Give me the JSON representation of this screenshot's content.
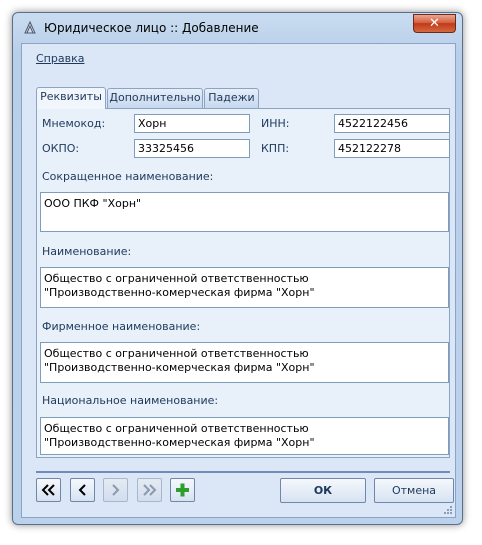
{
  "window": {
    "title": "Юридическое лицо :: Добавление",
    "close_label": "✕"
  },
  "menu": {
    "help": "Справка"
  },
  "tabs": [
    {
      "label": "Реквизиты",
      "active": true
    },
    {
      "label": "Дополнительно",
      "active": false
    },
    {
      "label": "Падежи",
      "active": false
    }
  ],
  "form": {
    "mnemocode": {
      "label": "Мнемокод:",
      "value": "Хорн"
    },
    "inn": {
      "label": "ИНН:",
      "value": "4522122456"
    },
    "okpo": {
      "label": "ОКПО:",
      "value": "33325456"
    },
    "kpp": {
      "label": "КПП:",
      "value": "452122278"
    },
    "short_name": {
      "label": "Сокращенное наименование:",
      "value": "ООО ПКФ \"Хорн\""
    },
    "name": {
      "label": "Наименование:",
      "value": "Общество с ограниченной ответственностью\n\"Производственно-комерческая фирма \"Хорн\""
    },
    "firm_name": {
      "label": "Фирменное наименование:",
      "value": "Общество с ограниченной ответственностью\n\"Производственно-комерческая фирма \"Хорн\""
    },
    "national_name": {
      "label": "Национальное наименование:",
      "value": "Общество с ограниченной ответственностью\n\"Производственно-комерческая фирма \"Хорн\""
    }
  },
  "buttons": {
    "ok": "ОК",
    "cancel": "Отмена"
  },
  "icons": {
    "first": "first-record-icon",
    "prev": "prev-record-icon",
    "next": "next-record-icon",
    "last": "last-record-icon",
    "add": "add-icon",
    "add_color": "#2e9e2e"
  }
}
